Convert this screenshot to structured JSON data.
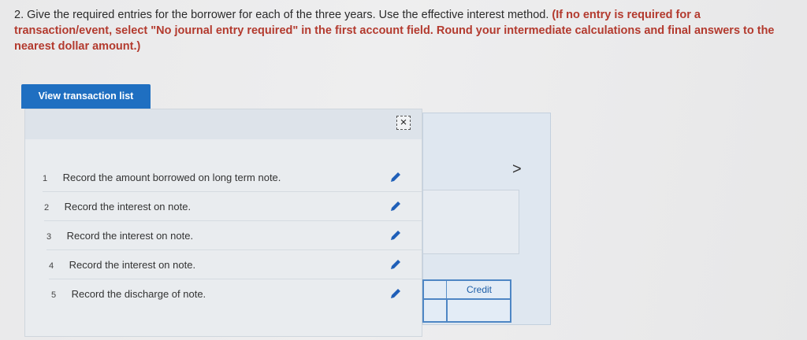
{
  "question": {
    "text": "2. Give the required entries for the borrower for each of the three years. Use the effective interest method.",
    "instructions": "(If no entry is required for a transaction/event, select \"No journal entry required\" in the first account field. Round your intermediate calculations and final answers to the nearest dollar amount.)"
  },
  "view_button": {
    "label": "View transaction list"
  },
  "transaction_list": {
    "close_label": "×",
    "rows": [
      {
        "num": "1",
        "label": "Record the amount borrowed on long term note."
      },
      {
        "num": "2",
        "label": "Record the interest on note."
      },
      {
        "num": "3",
        "label": "Record the interest on note."
      },
      {
        "num": "4",
        "label": "Record the interest on note."
      },
      {
        "num": "5",
        "label": "Record the discharge of note."
      }
    ]
  },
  "journal": {
    "next_label": ">",
    "credit_header": "Credit"
  },
  "colors": {
    "accent": "#1f6fc1",
    "instruction_red": "#b33a2e",
    "edit_icon": "#1f5fb8"
  },
  "icons": {
    "edit": "pencil-icon",
    "close": "close-icon",
    "next": "chevron-right-icon"
  }
}
